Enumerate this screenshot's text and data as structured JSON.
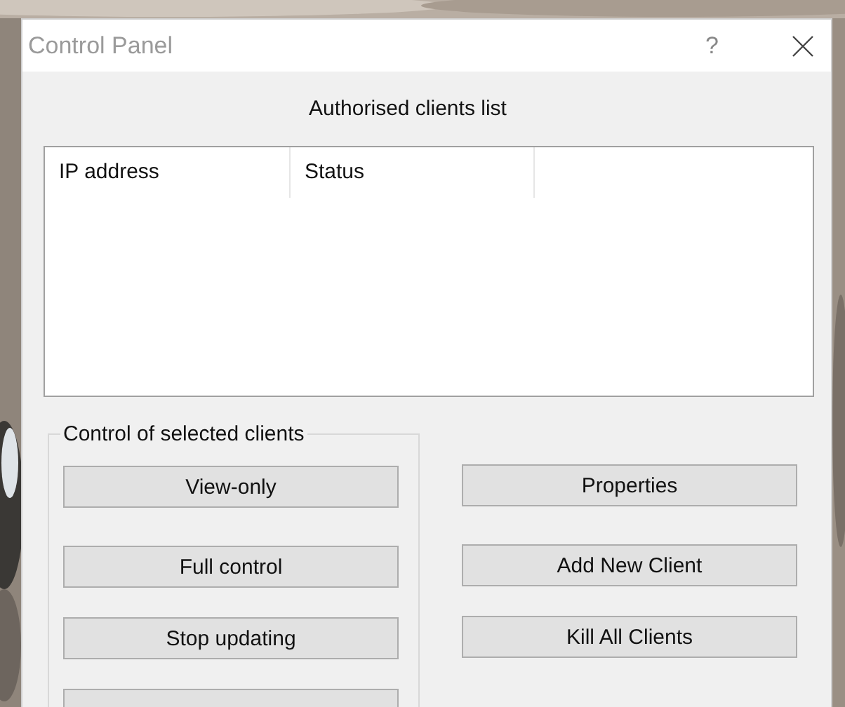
{
  "window": {
    "title": "Control Panel",
    "help": "?"
  },
  "clients_list": {
    "heading": "Authorised clients list",
    "columns": [
      "IP address",
      "Status"
    ]
  },
  "control_group": {
    "legend": "Control of selected clients",
    "buttons": [
      {
        "label": "View-only"
      },
      {
        "label": "Full control"
      },
      {
        "label": "Stop updating"
      }
    ],
    "button_cut_off_below": true
  },
  "side_buttons": [
    {
      "label": "Properties"
    },
    {
      "label": "Add New Client"
    },
    {
      "label": "Kill All Clients"
    }
  ]
}
